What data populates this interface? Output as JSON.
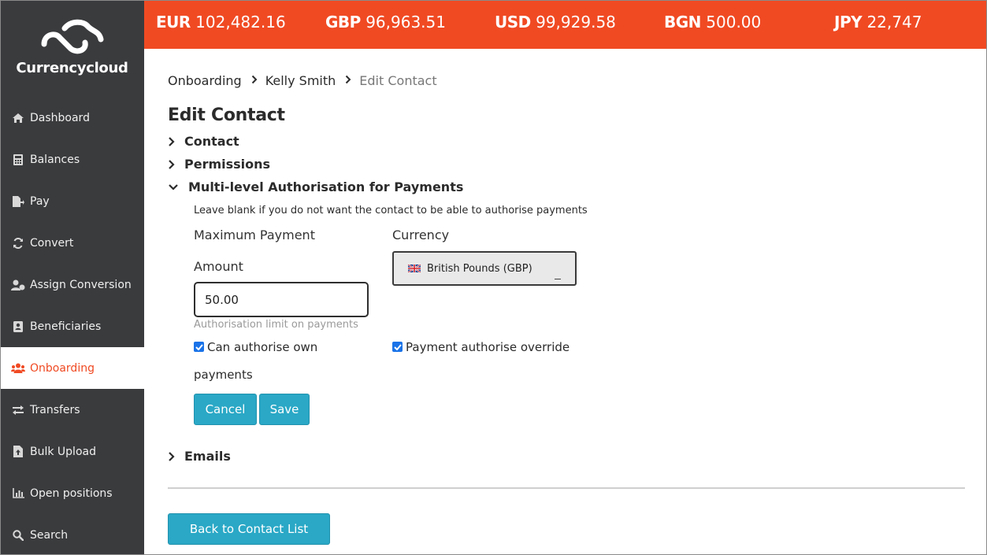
{
  "brand": {
    "name": "Currencycloud",
    "accent": "#f04a23",
    "sidebar_bg": "#3a3b3d",
    "button": "#2aa8c6"
  },
  "balances": [
    {
      "code": "EUR",
      "amount": "102,482.16"
    },
    {
      "code": "GBP",
      "amount": "96,963.51"
    },
    {
      "code": "USD",
      "amount": "99,929.58"
    },
    {
      "code": "BGN",
      "amount": "500.00"
    },
    {
      "code": "JPY",
      "amount": "22,747"
    }
  ],
  "sidebar": {
    "items": [
      {
        "label": "Dashboard",
        "icon": "home-icon"
      },
      {
        "label": "Balances",
        "icon": "calculator-icon"
      },
      {
        "label": "Pay",
        "icon": "pay-icon"
      },
      {
        "label": "Convert",
        "icon": "refresh-icon"
      },
      {
        "label": "Assign Conversion",
        "icon": "user-assign-icon"
      },
      {
        "label": "Beneficiaries",
        "icon": "address-book-icon"
      },
      {
        "label": "Onboarding",
        "icon": "users-icon",
        "active": true
      },
      {
        "label": "Transfers",
        "icon": "exchange-icon"
      },
      {
        "label": "Bulk Upload",
        "icon": "file-upload-icon"
      },
      {
        "label": "Open positions",
        "icon": "bar-chart-icon"
      },
      {
        "label": "Search",
        "icon": "search-icon"
      }
    ]
  },
  "breadcrumb": {
    "items": [
      "Onboarding",
      "Kelly Smith"
    ],
    "current": "Edit Contact"
  },
  "page": {
    "title": "Edit Contact"
  },
  "sections": {
    "contact": "Contact",
    "permissions": "Permissions",
    "mla": "Multi-level Authorisation for Payments",
    "emails": "Emails"
  },
  "mla": {
    "hint": "Leave blank if you do not want the contact to be able to authorise payments",
    "max_payment_label": "Maximum Payment",
    "amount_label": "Amount",
    "amount_value": "50.00",
    "amount_help": "Authorisation limit on payments",
    "currency_label": "Currency",
    "currency_value": "British Pounds (GBP)",
    "own_payments_label_1": "Can authorise own",
    "own_payments_label_2": "payments",
    "own_payments_checked": true,
    "override_label": "Payment authorise override",
    "override_checked": true,
    "cancel_label": "Cancel",
    "save_label": "Save"
  },
  "footer": {
    "back_label": "Back to Contact List"
  }
}
